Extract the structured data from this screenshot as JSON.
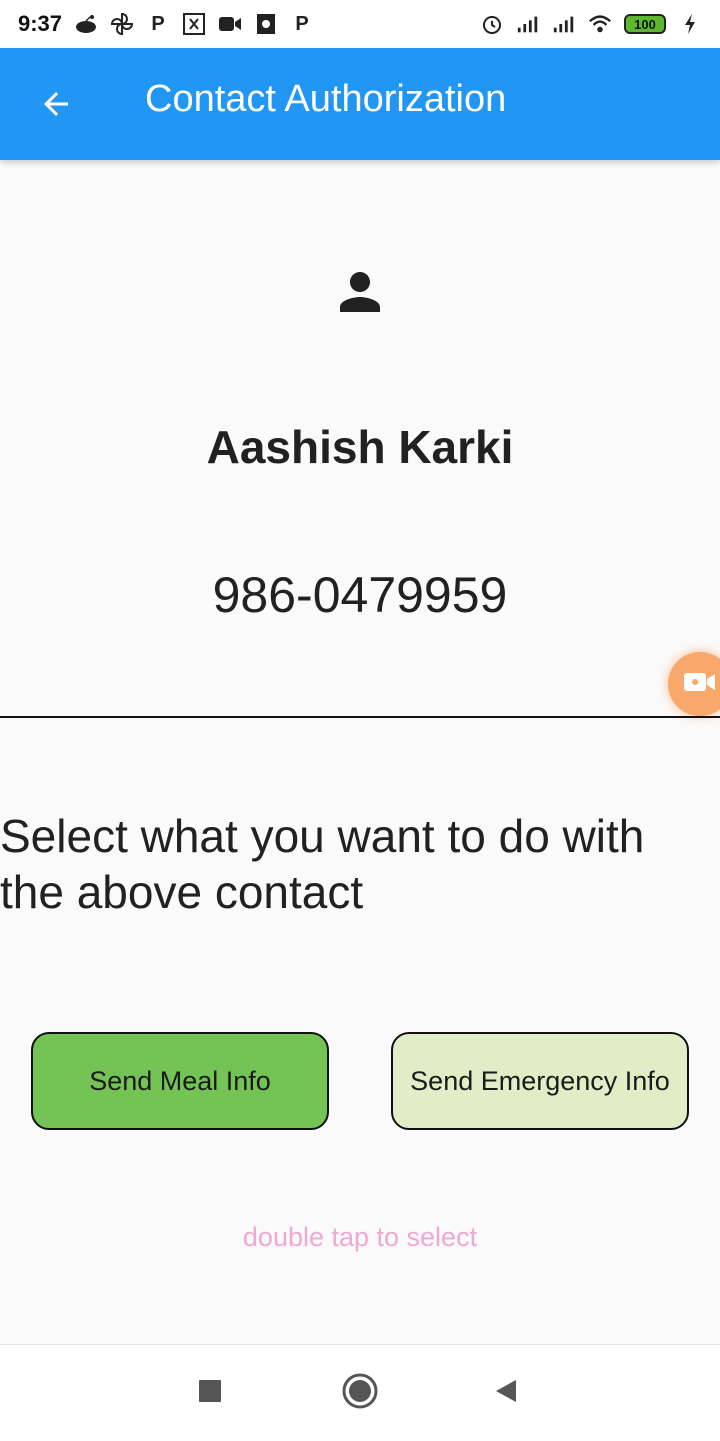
{
  "status_bar": {
    "time": "9:37",
    "left_icons": [
      "reddit-icon",
      "pinwheel-icon",
      "p-app-icon",
      "app-box-icon",
      "video-icon",
      "film-icon",
      "p-app-icon"
    ],
    "right_icons": [
      "alarm-icon",
      "signal-icon",
      "signal-icon",
      "wifi-icon",
      "battery-icon",
      "charging-icon"
    ],
    "p_glyph": "P",
    "battery_level": "100",
    "battery_color": "#5cb82f"
  },
  "app_bar": {
    "title": "Contact Authorization",
    "back_icon": "arrow-back-icon",
    "color": "#2196f3"
  },
  "contact": {
    "icon": "person-icon",
    "name": "Aashish Karki",
    "phone": "986-0479959"
  },
  "instruction": "Select what you want to do with the above contact",
  "actions": {
    "meal_label": "Send Meal Info",
    "meal_color": "#74c355",
    "emergency_label": "Send Emergency Info",
    "emergency_color": "#e0edc6"
  },
  "hint": "double tap to select",
  "hint_color": "#f0a7d6",
  "nav_bar": {
    "icons": [
      "recent-apps-icon",
      "home-icon",
      "back-icon"
    ]
  }
}
